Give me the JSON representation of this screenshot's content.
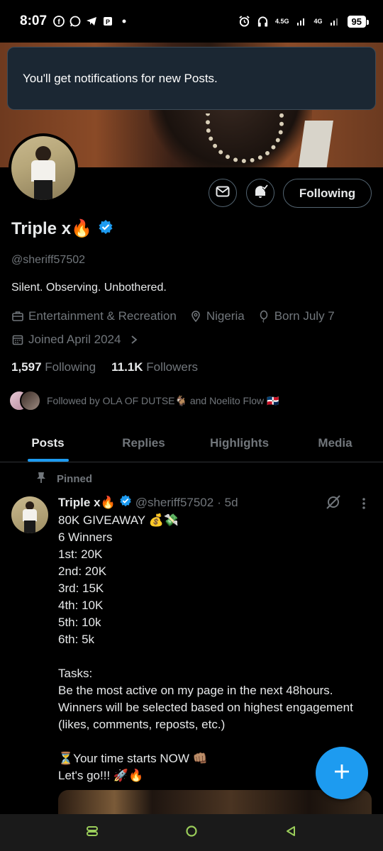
{
  "status_bar": {
    "time": "8:07",
    "network_1": "4.5G",
    "network_2": "4G",
    "battery": "95"
  },
  "toast": {
    "message": "You'll get notifications for new Posts."
  },
  "profile": {
    "display_name": "Triple x🔥",
    "handle": "@sheriff57502",
    "bio": "Silent. Observing. Unbothered.",
    "category": "Entertainment & Recreation",
    "location": "Nigeria",
    "born": "Born July 7",
    "joined": "Joined April 2024",
    "following_count": "1,597",
    "following_label": "Following",
    "followers_count": "11.1K",
    "followers_label": "Followers",
    "followed_by": "Followed by OLA OF DUTSE🐐 and Noelito Flow 🇩🇴",
    "follow_button": "Following"
  },
  "tabs": [
    {
      "label": "Posts",
      "active": true
    },
    {
      "label": "Replies",
      "active": false
    },
    {
      "label": "Highlights",
      "active": false
    },
    {
      "label": "Media",
      "active": false
    }
  ],
  "post": {
    "pinned_label": "Pinned",
    "author_name": "Triple x🔥",
    "author_handle": "@sheriff57502",
    "time": "· 5d",
    "body": "80K GIVEAWAY 💰💸\n6 Winners\n1st: 20K\n2nd: 20K\n3rd: 15K\n4th: 10K\n5th: 10k\n6th: 5k\n\nTasks:\nBe the most active on my page in the next 48hours.\nWinners will be selected based on highest engagement (likes, comments, reposts, etc.)\n\n⏳Your time starts NOW 👊🏽\nLet's go!!! 🚀🔥"
  },
  "colors": {
    "accent": "#1d9bf0",
    "muted": "#71767b",
    "text": "#e7e9ea",
    "background": "#000000"
  }
}
